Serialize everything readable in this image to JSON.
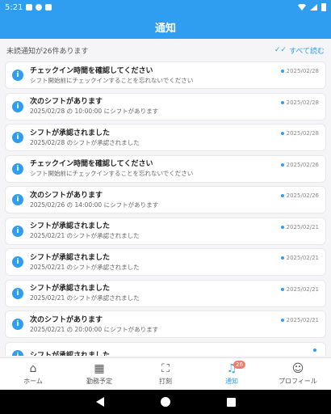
{
  "status_bar": {
    "time": "5:21"
  },
  "header": {
    "title": "通知"
  },
  "summary": {
    "unread_text": "未読通知が26件あります",
    "read_all_label": "すべて読む"
  },
  "notifications": [
    {
      "title": "チェックイン時間を確認してください",
      "body": "シフト開始前にチェックインすることを忘れないでください",
      "date": "2025/02/28"
    },
    {
      "title": "次のシフトがあります",
      "body": "2025/02/28 の 10:00:00 にシフトがあります",
      "date": "2025/02/28"
    },
    {
      "title": "シフトが承認されました",
      "body": "2025/02/28 のシフトが承認されました",
      "date": "2025/02/28"
    },
    {
      "title": "チェックイン時間を確認してください",
      "body": "シフト開始前にチェックインすることを忘れないでください",
      "date": "2025/02/26"
    },
    {
      "title": "次のシフトがあります",
      "body": "2025/02/26 の 14:00:00 にシフトがあります",
      "date": "2025/02/26"
    },
    {
      "title": "シフトが承認されました",
      "body": "2025/02/21 のシフトが承認されました",
      "date": "2025/02/21"
    },
    {
      "title": "シフトが承認されました",
      "body": "2025/02/21 のシフトが承認されました",
      "date": "2025/02/21"
    },
    {
      "title": "シフトが承認されました",
      "body": "2025/02/21 のシフトが承認されました",
      "date": "2025/02/21"
    },
    {
      "title": "次のシフトがあります",
      "body": "2025/02/21 の 20:00:00 にシフトがあります",
      "date": "2025/02/21"
    },
    {
      "title": "シフトが承認されました",
      "body": "",
      "date": ""
    }
  ],
  "bottom_nav": {
    "items": [
      {
        "label": "ホーム",
        "icon": "home-icon"
      },
      {
        "label": "勤務予定",
        "icon": "calendar-icon"
      },
      {
        "label": "打刻",
        "icon": "qr-scan-icon"
      },
      {
        "label": "通知",
        "icon": "bell-icon",
        "badge": "26"
      },
      {
        "label": "プロフィール",
        "icon": "person-icon"
      }
    ],
    "active_color": "#2f9ef0"
  },
  "colors": {
    "primary": "#2f9ef0",
    "badge": "#f07d6b"
  }
}
